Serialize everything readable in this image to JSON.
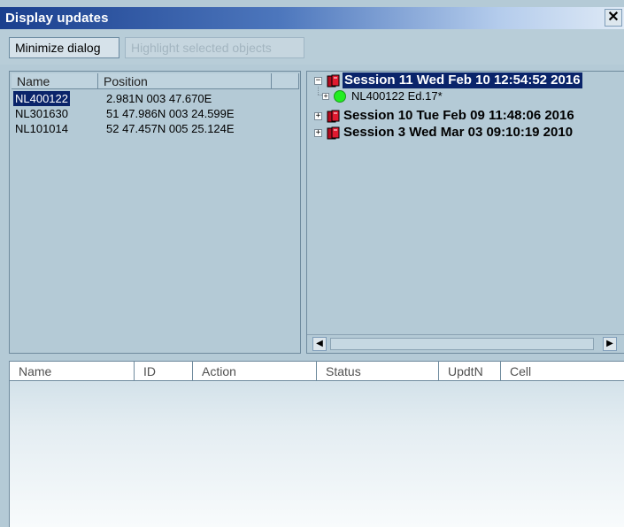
{
  "window": {
    "title": "Display updates",
    "close_label": "✕"
  },
  "toolbar": {
    "minimize_label": "Minimize dialog",
    "highlight_label": "Highlight selected objects"
  },
  "left_list": {
    "columns": [
      "Name",
      "Position"
    ],
    "rows": [
      {
        "name": "NL400122",
        "position": "2.981N 003 47.670E",
        "selected": true
      },
      {
        "name": "NL301630",
        "position": "51 47.986N 003 24.599E",
        "selected": false
      },
      {
        "name": "NL101014",
        "position": "52 47.457N 005 25.124E",
        "selected": false
      }
    ]
  },
  "tree": {
    "nodes": [
      {
        "label": "Session 11 Wed Feb 10 12:54:52 2016",
        "selected": true,
        "expanded": true
      },
      {
        "label": "NL400122 Ed.17*",
        "child": true,
        "status_color": "#22ee22"
      },
      {
        "label": "Session 10 Tue Feb 09 11:48:06 2016",
        "selected": false,
        "expanded": false
      },
      {
        "label": "Session 3 Wed Mar 03 09:10:19 2010",
        "selected": false,
        "expanded": false
      }
    ],
    "scroll_left_icon": "◀",
    "scroll_right_icon": "▶"
  },
  "updates_table": {
    "columns": [
      "Name",
      "ID",
      "Action",
      "Status",
      "UpdtN",
      "Cell"
    ]
  },
  "colors": {
    "titlebar_start": "#1a3f8e",
    "selection": "#0a246a",
    "dialog_bg": "#b4cad6",
    "status_ok": "#22ee22",
    "book_red": "#b40a1e"
  }
}
